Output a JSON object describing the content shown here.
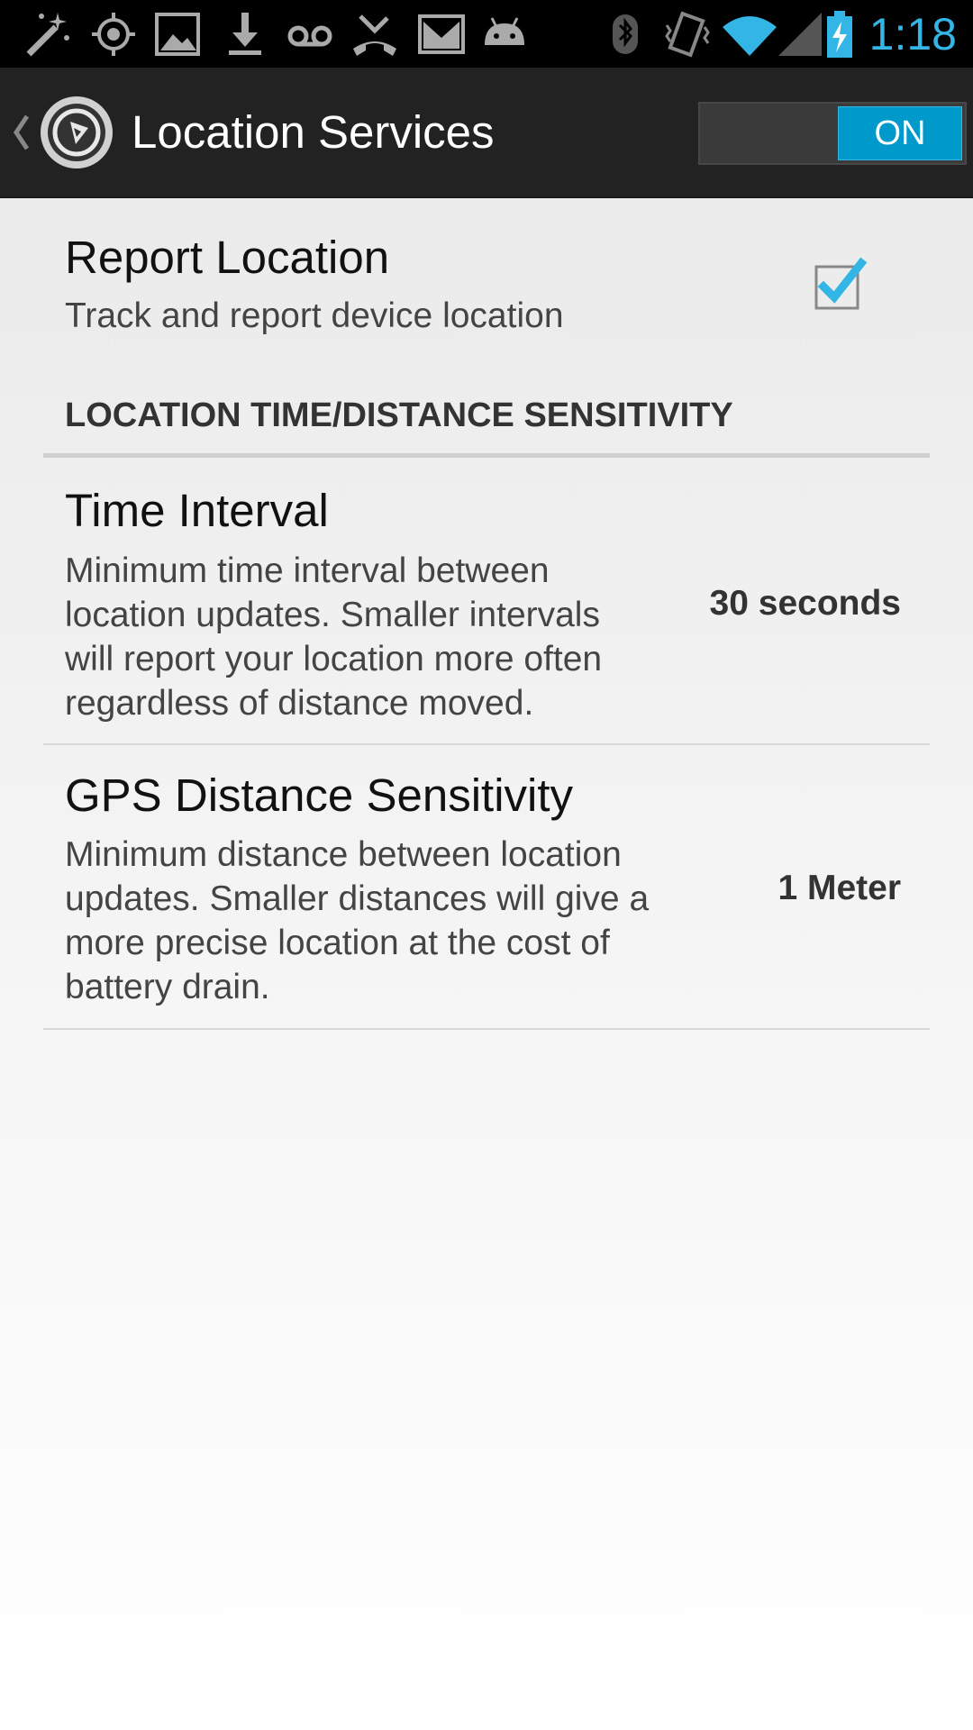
{
  "status_bar": {
    "icons": [
      "magic-wand-icon",
      "gps-icon",
      "picture-icon",
      "download-icon",
      "voicemail-icon",
      "missed-call-icon",
      "gmail-icon",
      "android-icon",
      "bluetooth-icon",
      "vibrate-icon",
      "wifi-icon",
      "signal-icon",
      "battery-charging-icon"
    ],
    "time": "1:18",
    "accent_color": "#33b5e5"
  },
  "action_bar": {
    "title": "Location Services",
    "switch_label": "ON",
    "switch_color": "#0099cc"
  },
  "report_location": {
    "title": "Report Location",
    "summary": "Track and report device location",
    "checked": true
  },
  "category": {
    "title": "LOCATION TIME/DISTANCE SENSITIVITY"
  },
  "time_interval": {
    "title": "Time Interval",
    "summary_lines": [
      "Minimum time interval between",
      "location updates. Smaller intervals",
      "will report your location more often",
      "regardless of distance moved."
    ],
    "value": "30 seconds"
  },
  "gps_distance": {
    "title": "GPS Distance Sensitivity",
    "summary_lines": [
      "Minimum distance between location",
      "updates. Smaller distances will give a",
      "more precise location at the cost of",
      "battery drain."
    ],
    "value": "1 Meter"
  }
}
